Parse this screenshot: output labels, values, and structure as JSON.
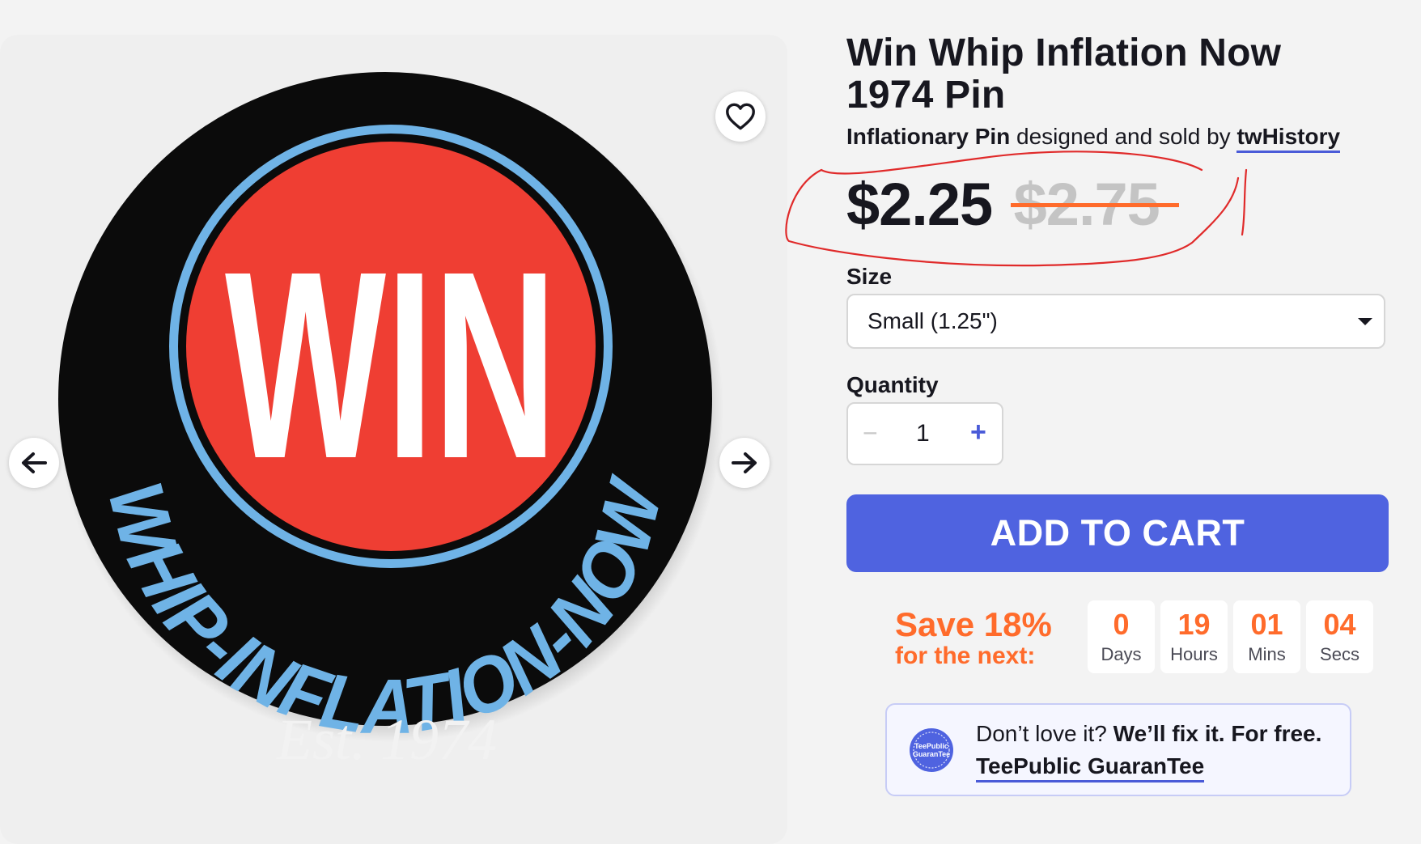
{
  "product": {
    "title": "Win Whip Inflation Now 1974 Pin",
    "design_name": "Inflationary Pin",
    "byline_middle": " designed and sold by ",
    "artist": "twHistory",
    "price_current": "$2.25",
    "price_original": "$2.75"
  },
  "image": {
    "pin_word": "WIN",
    "pin_arc_text": "WHIP-INFLATION-NOW",
    "pin_est": "Est. 1974"
  },
  "options": {
    "size_label": "Size",
    "size_value": "Small (1.25\")",
    "quantity_label": "Quantity",
    "quantity_minus": "−",
    "quantity_value": "1",
    "quantity_plus": "+"
  },
  "cart": {
    "add_to_cart_label": "ADD TO CART"
  },
  "sale": {
    "headline": "Save 18%",
    "subline": "for the next:",
    "countdown": [
      {
        "value": "0",
        "label": "Days"
      },
      {
        "value": "19",
        "label": "Hours"
      },
      {
        "value": "01",
        "label": "Mins"
      },
      {
        "value": "04",
        "label": "Secs"
      }
    ]
  },
  "guarantee": {
    "text_plain": "Don’t love it? ",
    "text_bold": "We’ll fix it. For free.",
    "link": "TeePublic GuaranTee",
    "badge_text": "TeePublic GuaranTee"
  },
  "icons": {
    "favorite": "heart-icon",
    "prev": "arrow-left-icon",
    "next": "arrow-right-icon",
    "dropdown": "caret-down-icon"
  },
  "colors": {
    "accent": "#4f63e0",
    "sale": "#ff6b2b",
    "pin_red": "#ef3e33",
    "pin_blue": "#6fb3e6"
  }
}
